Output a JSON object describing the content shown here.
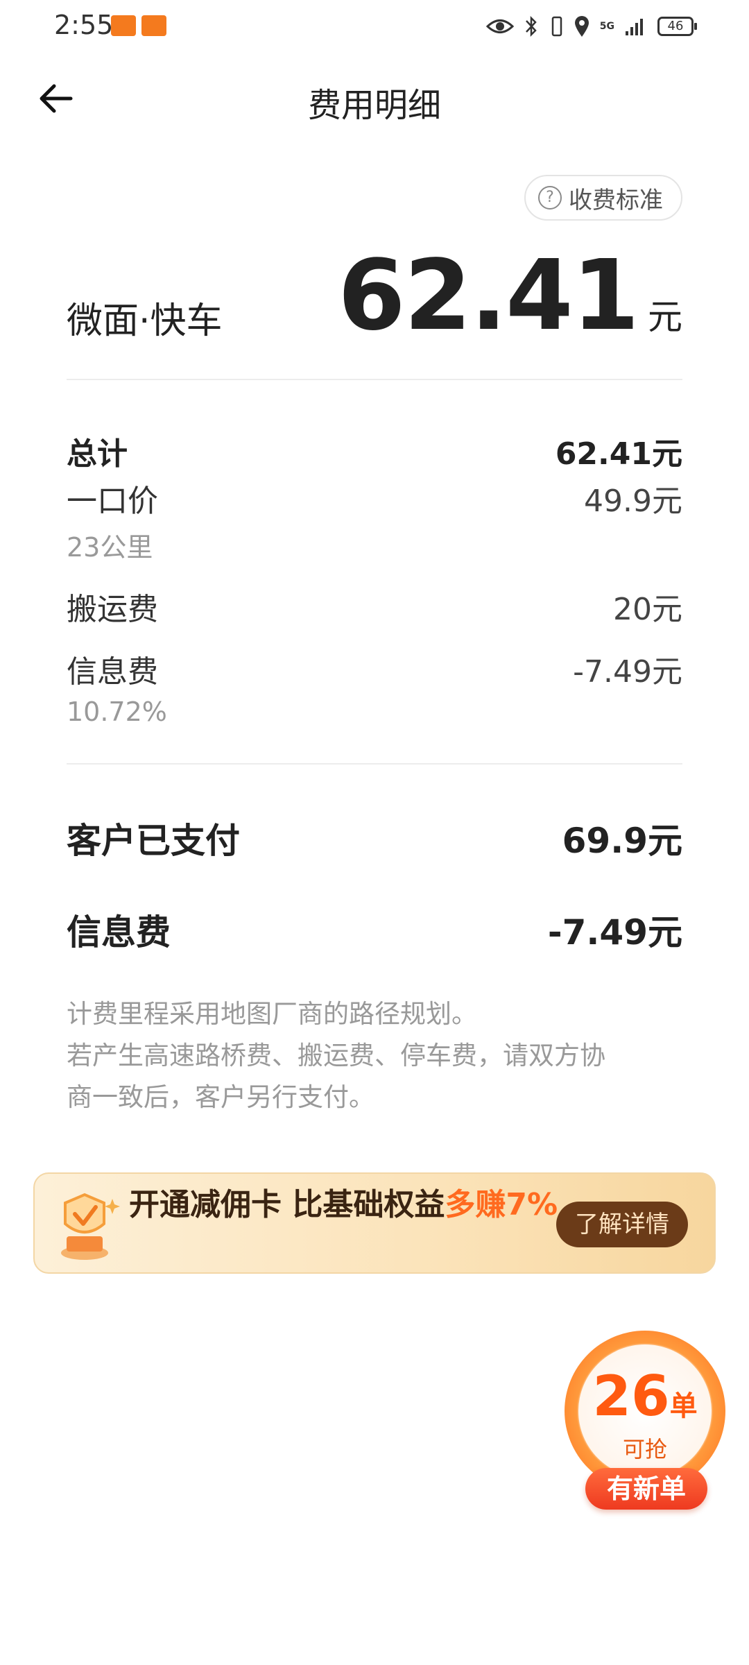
{
  "status_bar": {
    "time": "2:55",
    "battery": "46",
    "network": "5G"
  },
  "header": {
    "title": "费用明细"
  },
  "fee_standard": {
    "label": "收费标准",
    "icon_glyph": "?"
  },
  "summary": {
    "car_type": "微面·快车",
    "amount": "62.41",
    "unit": "元"
  },
  "breakdown": {
    "total_label": "总计",
    "total_value": "62.41元",
    "flat_label": "一口价",
    "flat_value": "49.9元",
    "distance": "23公里",
    "carry_label": "搬运费",
    "carry_value": "20元",
    "info_label": "信息费",
    "info_value": "-7.49元",
    "info_rate": "10.72%"
  },
  "settlement": {
    "paid_label": "客户已支付",
    "paid_value": "69.9元",
    "info_label": "信息费",
    "info_value": "-7.49元"
  },
  "note": {
    "line1": "计费里程采用地图厂商的路径规划。",
    "line2": "若产生高速路桥费、搬运费、停车费，请双方协",
    "line3": "商一致后，客户另行支付。"
  },
  "promo": {
    "text": "开通减佣卡 比基础权益",
    "highlight": "多赚7%",
    "button": "了解详情"
  },
  "order_badge": {
    "count": "26",
    "unit": "单",
    "sub": "可抢",
    "pill": "有新单"
  },
  "colors": {
    "accent": "#ff6a1f",
    "promo_button": "#6b3b18",
    "badge_pill": "#ee3a20"
  }
}
